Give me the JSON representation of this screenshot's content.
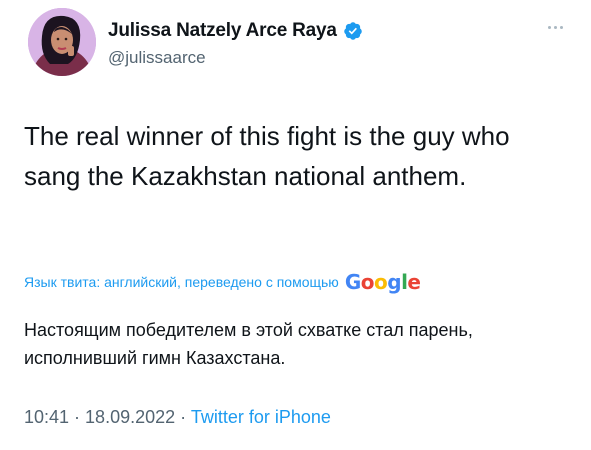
{
  "author": {
    "display_name": "Julissa Natzely Arce Raya",
    "handle": "@julissaarce",
    "verified_icon": "verified-badge-icon",
    "verified_color": "#1d9bf0"
  },
  "tweet": {
    "text": "The real winner of this fight is the guy who sang the Kazakhstan national anthem."
  },
  "translation": {
    "label": "Язык твита: английский, переведено с помощью",
    "provider_letters": [
      "G",
      "o",
      "o",
      "g",
      "l",
      "e"
    ],
    "text": "Настоящим победителем в этой схватке стал парень, исполнивший гимн Казахстана."
  },
  "meta": {
    "time": "10:41",
    "separator1": " · ",
    "date": "18.09.2022",
    "separator2": " · ",
    "source": "Twitter for iPhone"
  },
  "colors": {
    "link": "#1d9bf0",
    "secondary_text": "#536471",
    "primary_text": "#0f1419"
  }
}
